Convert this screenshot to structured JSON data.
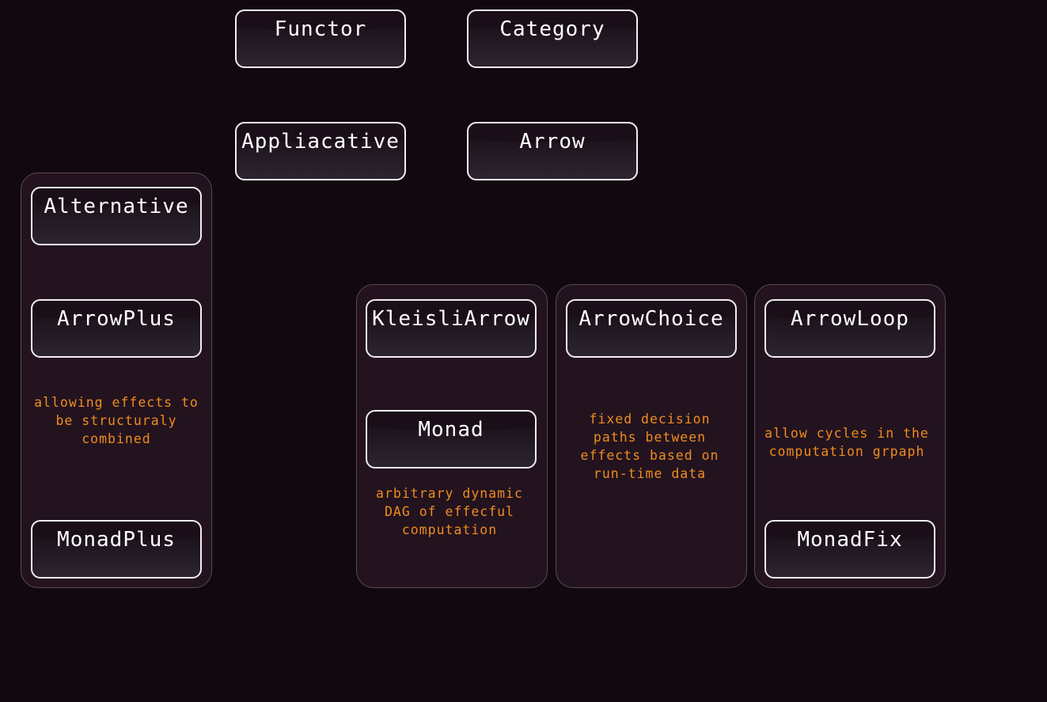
{
  "nodes": {
    "functor": "Functor",
    "category": "Category",
    "applicative": "Appliacative",
    "arrow": "Arrow",
    "alternative": "Alternative",
    "arrow_plus": "ArrowPlus",
    "monad_plus": "MonadPlus",
    "kleisli_arrow": "KleisliArrow",
    "monad": "Monad",
    "arrow_choice": "ArrowChoice",
    "arrow_loop": "ArrowLoop",
    "monad_fix": "MonadFix"
  },
  "notes": {
    "alternative_group": "allowing effects to be structuraly combined",
    "kleisli_group": "arbitrary dynamic DAG of effecful computation",
    "choice_group": "fixed decision paths between effects based on run-time data",
    "loop_group": "allow cycles in the computation grpaph"
  },
  "colors": {
    "background": "#120910",
    "panel": "#22131f",
    "node_border": "#f2eef2",
    "node_text": "#ffffff",
    "note_text": "#f08c1e"
  }
}
